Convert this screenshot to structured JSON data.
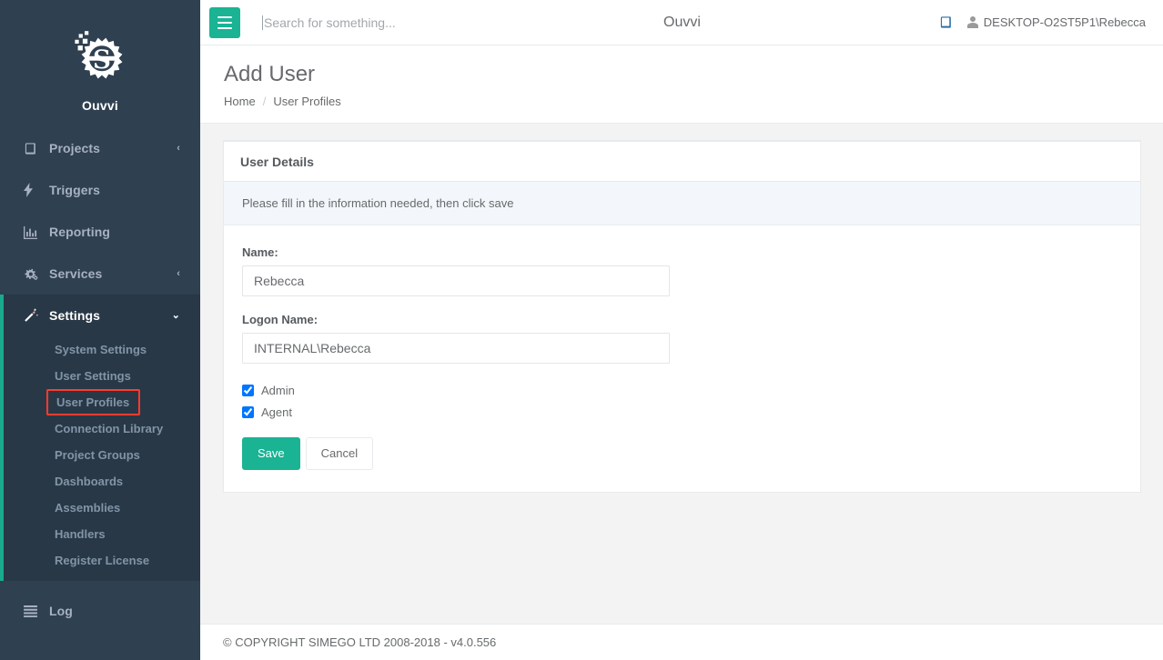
{
  "brand": {
    "name": "Ouvvi",
    "logo_icon": "gear-s-logo-icon"
  },
  "sidebar": {
    "items": [
      {
        "label": "Projects",
        "icon": "book-icon",
        "caret": "‹",
        "has_caret": true,
        "active": false
      },
      {
        "label": "Triggers",
        "icon": "bolt-icon",
        "caret": "",
        "has_caret": false,
        "active": false
      },
      {
        "label": "Reporting",
        "icon": "bar-chart-icon",
        "caret": "",
        "has_caret": false,
        "active": false
      },
      {
        "label": "Services",
        "icon": "gears-icon",
        "caret": "‹",
        "has_caret": true,
        "active": false
      },
      {
        "label": "Settings",
        "icon": "magic-wand-icon",
        "caret": "⌄",
        "has_caret": true,
        "active": true
      }
    ],
    "submenu": [
      {
        "label": "System Settings",
        "highlighted": false
      },
      {
        "label": "User Settings",
        "highlighted": false
      },
      {
        "label": "User Profiles",
        "highlighted": true
      },
      {
        "label": "Connection Library",
        "highlighted": false
      },
      {
        "label": "Project Groups",
        "highlighted": false
      },
      {
        "label": "Dashboards",
        "highlighted": false
      },
      {
        "label": "Assemblies",
        "highlighted": false
      },
      {
        "label": "Handlers",
        "highlighted": false
      },
      {
        "label": "Register License",
        "highlighted": false
      }
    ],
    "log": {
      "label": "Log",
      "icon": "list-icon"
    },
    "highlight_color": "#ff3b30",
    "accent_color": "#19aa8d",
    "background_color": "#2f4050"
  },
  "topbar": {
    "menu_toggle_icon": "hamburger-icon",
    "search": {
      "value": "",
      "placeholder": "Search for something..."
    },
    "app_title": "Ouvvi",
    "book_icon": "book-icon",
    "user_icon": "user-icon",
    "user_name": "DESKTOP-O2ST5P1\\Rebecca"
  },
  "page": {
    "title": "Add User",
    "breadcrumb": {
      "home": "Home",
      "separator": "/",
      "current": "User Profiles"
    }
  },
  "card": {
    "heading": "User Details",
    "alert": "Please fill in the information needed, then click save",
    "fields": [
      {
        "label": "Name:",
        "value": "Rebecca"
      },
      {
        "label": "Logon Name:",
        "value": "INTERNAL\\Rebecca"
      }
    ],
    "checkboxes": [
      {
        "label": "Admin",
        "checked": true
      },
      {
        "label": "Agent",
        "checked": true
      }
    ],
    "buttons": {
      "save": "Save",
      "cancel": "Cancel"
    },
    "accent_color": "#1ab394"
  },
  "footer": {
    "copyright": "© COPYRIGHT SIMEGO LTD 2008-2018 - v4.0.556"
  }
}
